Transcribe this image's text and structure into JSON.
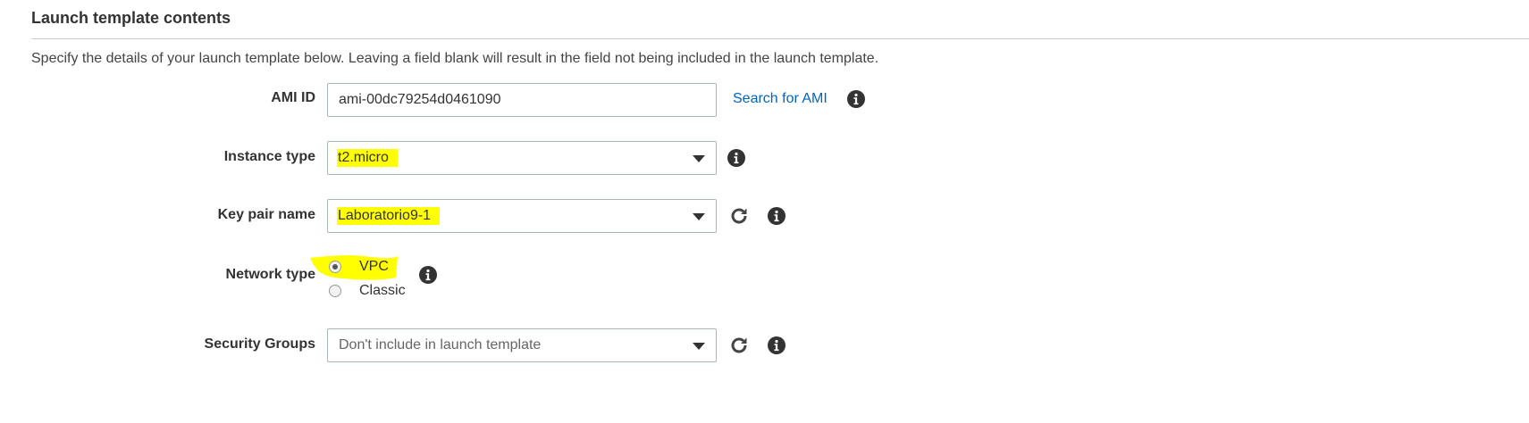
{
  "section": {
    "title": "Launch template contents",
    "description": "Specify the details of your launch template below. Leaving a field blank will result in the field not being included in the launch template."
  },
  "ami": {
    "label": "AMI ID",
    "value": "ami-00dc79254d0461090",
    "search_link": "Search for AMI"
  },
  "instance_type": {
    "label": "Instance type",
    "value": "t2.micro"
  },
  "key_pair": {
    "label": "Key pair name",
    "value": "Laboratorio9-1"
  },
  "network_type": {
    "label": "Network type",
    "options": [
      {
        "label": "VPC",
        "selected": true
      },
      {
        "label": "Classic",
        "selected": false
      }
    ]
  },
  "security_groups": {
    "label": "Security Groups",
    "value": "Don't include in launch template"
  },
  "colors": {
    "link": "#0066bb",
    "highlight": "#ffff00",
    "border": "#aab7b8"
  },
  "icons": {
    "info": "info-icon",
    "refresh": "refresh-icon",
    "dropdown": "chevron-down-icon"
  }
}
